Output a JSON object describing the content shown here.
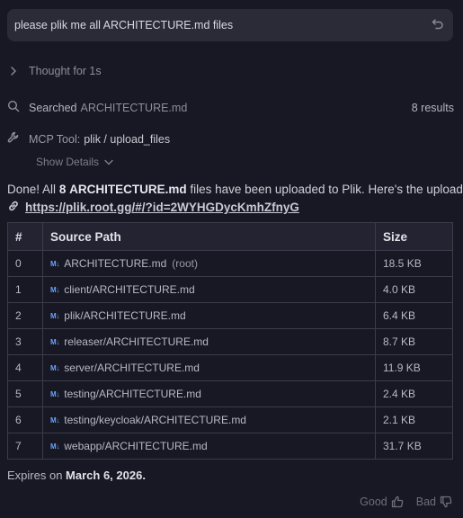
{
  "prompt": {
    "text": "please plik me all ARCHITECTURE.md files"
  },
  "thought": {
    "label": "Thought for 1s"
  },
  "search": {
    "label": "Searched",
    "query": "ARCHITECTURE.md",
    "results": "8 results"
  },
  "mcp": {
    "label": "MCP Tool:",
    "tool": "plik / upload_files",
    "show_details": "Show Details"
  },
  "message": {
    "prefix": "Done! All",
    "count": "8",
    "filename": "ARCHITECTURE.md",
    "suffix": "files have been uploaded to Plik. Here's the upload:",
    "link": "https://plik.root.gg/#/?id=2WYHGDycKmhZfnyG"
  },
  "table": {
    "headers": [
      "#",
      "Source Path",
      "Size"
    ],
    "rows": [
      {
        "num": "0",
        "path": "ARCHITECTURE.md",
        "note": "(root)",
        "size": "18.5 KB"
      },
      {
        "num": "1",
        "path": "client/ARCHITECTURE.md",
        "note": "",
        "size": "4.0 KB"
      },
      {
        "num": "2",
        "path": "plik/ARCHITECTURE.md",
        "note": "",
        "size": "6.4 KB"
      },
      {
        "num": "3",
        "path": "releaser/ARCHITECTURE.md",
        "note": "",
        "size": "8.7 KB"
      },
      {
        "num": "4",
        "path": "server/ARCHITECTURE.md",
        "note": "",
        "size": "11.9 KB"
      },
      {
        "num": "5",
        "path": "testing/ARCHITECTURE.md",
        "note": "",
        "size": "2.4 KB"
      },
      {
        "num": "6",
        "path": "testing/keycloak/ARCHITECTURE.md",
        "note": "",
        "size": "2.1 KB"
      },
      {
        "num": "7",
        "path": "webapp/ARCHITECTURE.md",
        "note": "",
        "size": "31.7 KB"
      }
    ],
    "md_badge": "M↓"
  },
  "expires": {
    "label": "Expires on",
    "date": "March 6, 2026."
  },
  "feedback": {
    "good": "Good",
    "bad": "Bad"
  },
  "icons": {
    "undo": "undo-icon",
    "chevron": "chevron-right-icon",
    "search": "search-icon",
    "tool": "wrench-icon",
    "link": "link-icon",
    "markdown": "markdown-icon",
    "thumbs_up": "thumbs-up-icon",
    "thumbs_down": "thumbs-down-icon"
  },
  "colors": {
    "background": "#181824",
    "bubble": "#2b2b38",
    "markdown_accent": "#6aa3ff"
  }
}
